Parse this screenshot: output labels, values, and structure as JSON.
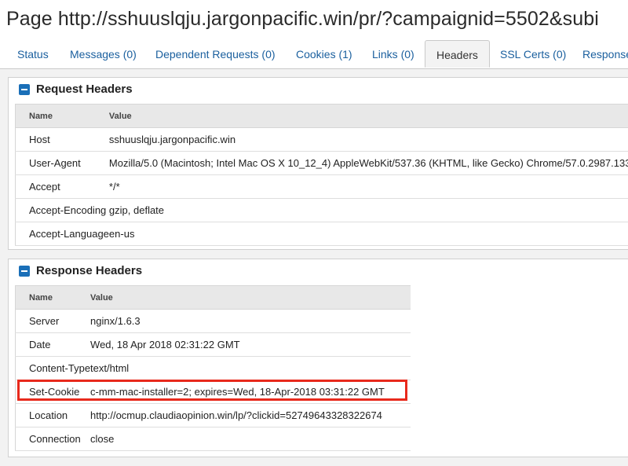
{
  "title": "Page http://sshuuslqju.jargonpacific.win/pr/?campaignid=5502&subi",
  "tabs": [
    {
      "label": "Status"
    },
    {
      "label": "Messages (0)"
    },
    {
      "label": "Dependent Requests (0)"
    },
    {
      "label": "Cookies (1)"
    },
    {
      "label": "Links (0)"
    },
    {
      "label": "Headers",
      "active": true
    },
    {
      "label": "SSL Certs (0)"
    },
    {
      "label": "Response"
    }
  ],
  "request": {
    "title": "Request Headers",
    "col_name": "Name",
    "col_value": "Value",
    "rows": [
      {
        "name": "Host",
        "value": "sshuuslqju.jargonpacific.win"
      },
      {
        "name": "User-Agent",
        "value": "Mozilla/5.0 (Macintosh; Intel Mac OS X 10_12_4) AppleWebKit/537.36 (KHTML, like Gecko) Chrome/57.0.2987.133"
      },
      {
        "name": "Accept",
        "value": "*/*"
      },
      {
        "name": "Accept-Encoding",
        "value": "gzip, deflate"
      },
      {
        "name": "Accept-Language",
        "value": "en-us"
      }
    ]
  },
  "response": {
    "title": "Response Headers",
    "col_name": "Name",
    "col_value": "Value",
    "rows": [
      {
        "name": "Server",
        "value": "nginx/1.6.3"
      },
      {
        "name": "Date",
        "value": "Wed, 18 Apr 2018 02:31:22 GMT"
      },
      {
        "name": "Content-Type",
        "value": "text/html"
      },
      {
        "name": "Set-Cookie",
        "value": "c-mm-mac-installer=2; expires=Wed, 18-Apr-2018 03:31:22 GMT"
      },
      {
        "name": "Location",
        "value": "http://ocmup.claudiaopinion.win/lp/?clickid=52749643328322674"
      },
      {
        "name": "Connection",
        "value": "close"
      }
    ]
  },
  "colors": {
    "accent": "#1a6fb8",
    "highlight": "#e8291c"
  },
  "icons": {
    "panel_toggle": "collapse-minus-icon"
  }
}
